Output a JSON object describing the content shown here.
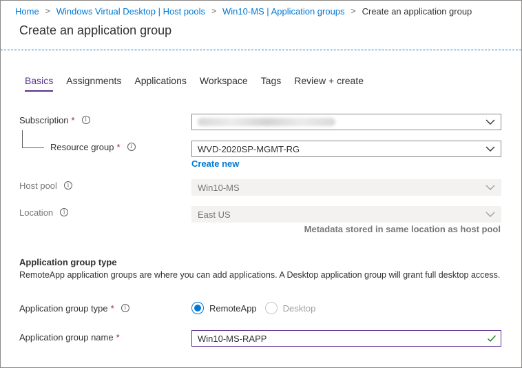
{
  "breadcrumb": [
    {
      "label": "Home",
      "link": true
    },
    {
      "label": "Windows Virtual Desktop | Host pools",
      "link": true
    },
    {
      "label": "Win10-MS | Application groups",
      "link": true
    },
    {
      "label": "Create an application group",
      "link": false
    }
  ],
  "page": {
    "title": "Create an application group"
  },
  "tabs": [
    {
      "label": "Basics",
      "active": true
    },
    {
      "label": "Assignments"
    },
    {
      "label": "Applications"
    },
    {
      "label": "Workspace"
    },
    {
      "label": "Tags"
    },
    {
      "label": "Review + create"
    }
  ],
  "form": {
    "required_marker": "*",
    "info_glyph": "i",
    "subscription": {
      "label": "Subscription",
      "value": ""
    },
    "resource_group": {
      "label": "Resource group",
      "value": "WVD-2020SP-MGMT-RG",
      "create_new": "Create new"
    },
    "host_pool": {
      "label": "Host pool",
      "value": "Win10-MS"
    },
    "location": {
      "label": "Location",
      "value": "East US",
      "hint": "Metadata stored in same location as host pool"
    },
    "section": {
      "title": "Application group type",
      "description": "RemoteApp application groups are where you can add applications. A Desktop application group will grant full desktop access."
    },
    "group_type": {
      "label": "Application group type",
      "options": [
        "RemoteApp",
        "Desktop"
      ],
      "selected": "RemoteApp"
    },
    "group_name": {
      "label": "Application group name",
      "value": "Win10-MS-RAPP"
    }
  },
  "colors": {
    "accent": "#0078d4",
    "active_tab": "#5c2d91",
    "required": "#a4262c",
    "valid": "#107c10"
  },
  "icons": {
    "dropdown": "chevron-down-icon",
    "info": "info-icon",
    "valid": "checkmark-icon"
  }
}
